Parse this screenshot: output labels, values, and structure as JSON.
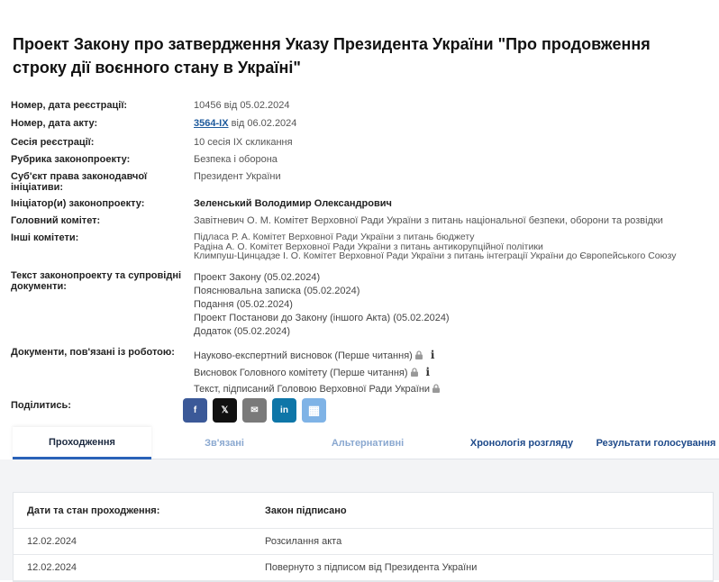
{
  "title": "Проект Закону про затвердження Указу Президента України \"Про продовження строку дії воєнного стану в Україні\"",
  "fields": {
    "reg_label": "Номер, дата реєстрації:",
    "reg_value": "10456 від 05.02.2024",
    "act_label": "Номер, дата акту:",
    "act_link": "3564-IX",
    "act_date": "від 06.02.2024",
    "session_label": "Сесія реєстрації:",
    "session_value": "10 сесія IX скликання",
    "rubric_label": "Рубрика законопроекту:",
    "rubric_value": "Безпека і оборона",
    "subject_label": "Суб'єкт права законодавчої ініціативи:",
    "subject_value": "Президент України",
    "initiator_label": "Ініціатор(и) законопроекту:",
    "initiator_value": "Зеленський Володимир Олександрович",
    "main_committee_label": "Головний комітет:",
    "main_committee_value": "Завітневич О. М. Комітет Верховної Ради України з питань національної безпеки, оборони та розвідки",
    "other_committees_label": "Інші комітети:",
    "other_committees": [
      "Підласа Р. А. Комітет Верховної Ради України з питань бюджету",
      "Радіна А. О. Комітет Верховної Ради України з питань антикорупційної політики",
      "Климпуш-Цинцадзе І. О. Комітет Верховної Ради України з питань інтеграції України до Європейського Союзу"
    ],
    "docs_label": "Текст законопроекту та супровідні документи:",
    "docs": [
      "Проект Закону (05.02.2024)",
      "Пояснювальна записка (05.02.2024)",
      "Подання (05.02.2024)",
      "Проект Постанови до Закону (іншого Акта) (05.02.2024)",
      "Додаток (05.02.2024)"
    ],
    "work_docs_label": "Документи, пов'язані із роботою:",
    "work_docs": [
      "Науково-експертний висновок (Перше читання)",
      "Висновок Головного комітету (Перше читання)",
      "Текст, підписаний Головою Верховної Ради України"
    ],
    "share_label": "Поділитись:"
  },
  "share_buttons": [
    {
      "name": "facebook",
      "glyph": "f",
      "color": "#3b5998"
    },
    {
      "name": "x",
      "glyph": "𝕏",
      "color": "#111111"
    },
    {
      "name": "email",
      "glyph": "✉",
      "color": "#7a7a7a"
    },
    {
      "name": "linkedin",
      "glyph": "in",
      "color": "#0e76a8"
    },
    {
      "name": "qr",
      "glyph": "▦",
      "color": "#7fb3e6"
    }
  ],
  "tabs": [
    "Проходження",
    "Зв'язані",
    "Альтернативні",
    "Хронологія розгляду",
    "Результати голосування"
  ],
  "table": {
    "headers": [
      "Дати та стан проходження:",
      "Закон підписано"
    ],
    "rows": [
      [
        "12.02.2024",
        "Розсилання акта"
      ],
      [
        "12.02.2024",
        "Повернуто з підписом від Президента України"
      ]
    ]
  }
}
